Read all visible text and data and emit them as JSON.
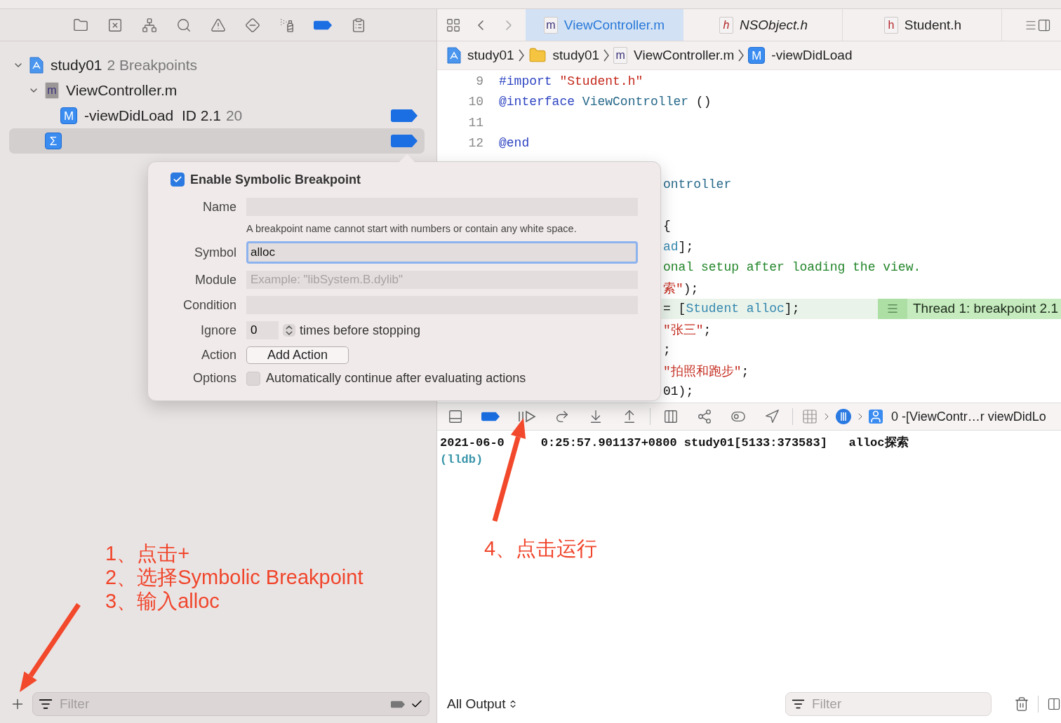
{
  "navigator": {
    "tools": [
      {
        "kind": "files",
        "selected": false
      },
      {
        "kind": "source-control",
        "selected": false
      },
      {
        "kind": "symbols",
        "selected": false
      },
      {
        "kind": "find",
        "selected": false
      },
      {
        "kind": "issues",
        "selected": false
      },
      {
        "kind": "tests",
        "selected": false
      },
      {
        "kind": "debug",
        "selected": false
      },
      {
        "kind": "breakpoints",
        "selected": true
      },
      {
        "kind": "reports",
        "selected": false
      }
    ],
    "tree": [
      {
        "kind": "project",
        "label": "study01",
        "detail": "2 Breakpoints",
        "expanded": true,
        "children": [
          {
            "kind": "file",
            "badge": "m",
            "label": "ViewController.m",
            "expanded": true,
            "children": [
              {
                "kind": "method",
                "badge": "M",
                "label": "-viewDidLoad  ID 2.1",
                "detail": "20",
                "enabled": true,
                "selected": false
              }
            ]
          },
          {
            "kind": "symbolic",
            "badge": "Σ",
            "enabled": true,
            "selected": true
          }
        ]
      }
    ],
    "filter": {
      "placeholder": "Filter"
    }
  },
  "editor": {
    "tabs": [
      {
        "badge": "m",
        "label": "ViewController.m",
        "selected": true,
        "preview": false
      },
      {
        "badge": "h",
        "label": "NSObject.h",
        "selected": false,
        "preview": true
      },
      {
        "badge": "h",
        "label": "Student.h",
        "selected": false,
        "preview": false
      }
    ],
    "jump_bar": [
      {
        "kind": "project",
        "label": "study01"
      },
      {
        "kind": "folder",
        "label": "study01"
      },
      {
        "kind": "file",
        "badge": "m",
        "label": "ViewController.m"
      },
      {
        "kind": "method",
        "badge": "M",
        "label": "-viewDidLoad"
      }
    ],
    "lines": [
      {
        "kind": "code",
        "number": "9",
        "tokens": [
          {
            "text": "#import ",
            "kind": "keyword"
          },
          {
            "text": "\"Student.h\"",
            "kind": "string"
          }
        ]
      },
      {
        "kind": "code",
        "number": "10",
        "tokens": [
          {
            "text": "@interface ",
            "kind": "keyword"
          },
          {
            "text": "ViewController",
            "kind": "type"
          },
          {
            "text": " ()",
            "kind": "plain"
          }
        ]
      },
      {
        "kind": "code",
        "number": "11"
      },
      {
        "kind": "code",
        "number": "12",
        "tokens": [
          {
            "text": "@end",
            "kind": "keyword"
          }
        ]
      },
      {
        "kind": "blank"
      },
      {
        "kind": "covered",
        "tokens": [
          {
            "text": "ontroller",
            "kind": "type"
          }
        ]
      },
      {
        "kind": "blank"
      },
      {
        "kind": "covered",
        "tokens": [
          {
            "text": "{",
            "kind": "plain"
          }
        ]
      },
      {
        "kind": "covered",
        "tokens": [
          {
            "text": "ad",
            "kind": "method"
          },
          {
            "text": "];",
            "kind": "plain"
          }
        ]
      },
      {
        "kind": "covered",
        "tokens": [
          {
            "text": "onal setup after loading the view.",
            "kind": "comment"
          }
        ]
      },
      {
        "kind": "covered",
        "tokens": [
          {
            "text": "索\"",
            "kind": "string"
          },
          {
            "text": ");",
            "kind": "plain"
          }
        ]
      },
      {
        "kind": "covered",
        "highlighted": true,
        "annotation": "Thread 1: breakpoint 2.1",
        "tokens": [
          {
            "text": "= [",
            "kind": "plain"
          },
          {
            "text": "Student alloc",
            "kind": "method"
          },
          {
            "text": "];",
            "kind": "plain"
          }
        ]
      },
      {
        "kind": "covered",
        "tokens": [
          {
            "text": "\"张三\"",
            "kind": "string"
          },
          {
            "text": ";",
            "kind": "plain"
          }
        ]
      },
      {
        "kind": "covered",
        "tokens": [
          {
            "text": ";",
            "kind": "plain"
          }
        ]
      },
      {
        "kind": "covered",
        "tokens": [
          {
            "text": "\"拍照和跑步\"",
            "kind": "string"
          },
          {
            "text": ";",
            "kind": "plain"
          }
        ]
      },
      {
        "kind": "covered",
        "tokens": [
          {
            "text": "01);",
            "kind": "plain"
          }
        ]
      }
    ]
  },
  "popover": {
    "enabled": true,
    "title": "Enable Symbolic Breakpoint",
    "fields": [
      {
        "kind": "text",
        "label": "Name",
        "hint": "A breakpoint name cannot start with numbers or contain any white space.",
        "focused": false
      },
      {
        "kind": "text",
        "label": "Symbol",
        "value": "alloc",
        "focused": true
      },
      {
        "kind": "text",
        "label": "Module",
        "placeholder": "Example: \"libSystem.B.dylib\"",
        "focused": false
      },
      {
        "kind": "text",
        "label": "Condition",
        "focused": false
      },
      {
        "kind": "stepper",
        "label": "Ignore",
        "value": "0",
        "suffix": "times before stopping"
      },
      {
        "kind": "button",
        "label": "Action",
        "button": "Add Action"
      },
      {
        "kind": "checkbox",
        "label": "Options",
        "text": "Automatically continue after evaluating actions",
        "checked": false
      }
    ]
  },
  "debug_bar": {
    "tools": [
      {
        "kind": "console-toggle"
      },
      {
        "kind": "breakpoints",
        "on": true
      },
      {
        "kind": "continue"
      },
      {
        "kind": "step-over"
      },
      {
        "kind": "step-into"
      },
      {
        "kind": "step-out"
      },
      {
        "kind": "separator"
      },
      {
        "kind": "view-debugger"
      },
      {
        "kind": "memory-graph"
      },
      {
        "kind": "environment"
      },
      {
        "kind": "location"
      },
      {
        "kind": "separator"
      }
    ],
    "path": [
      {
        "kind": "app"
      },
      {
        "kind": "thread"
      },
      {
        "kind": "frame",
        "label": "0 -[ViewContr…r viewDidLo"
      }
    ]
  },
  "console": {
    "log": [
      "2021-06-0",
      "0:25:57.901137+0800 study01[5133:373583]   alloc探索"
    ],
    "prompt": "(lldb)"
  },
  "console_footer": {
    "output": "All Output",
    "filter_placeholder": "Filter"
  },
  "annotations": {
    "steps": [
      "1、点击+",
      "2、选择Symbolic Breakpoint",
      "3、输入alloc"
    ],
    "note": "4、点击运行"
  }
}
